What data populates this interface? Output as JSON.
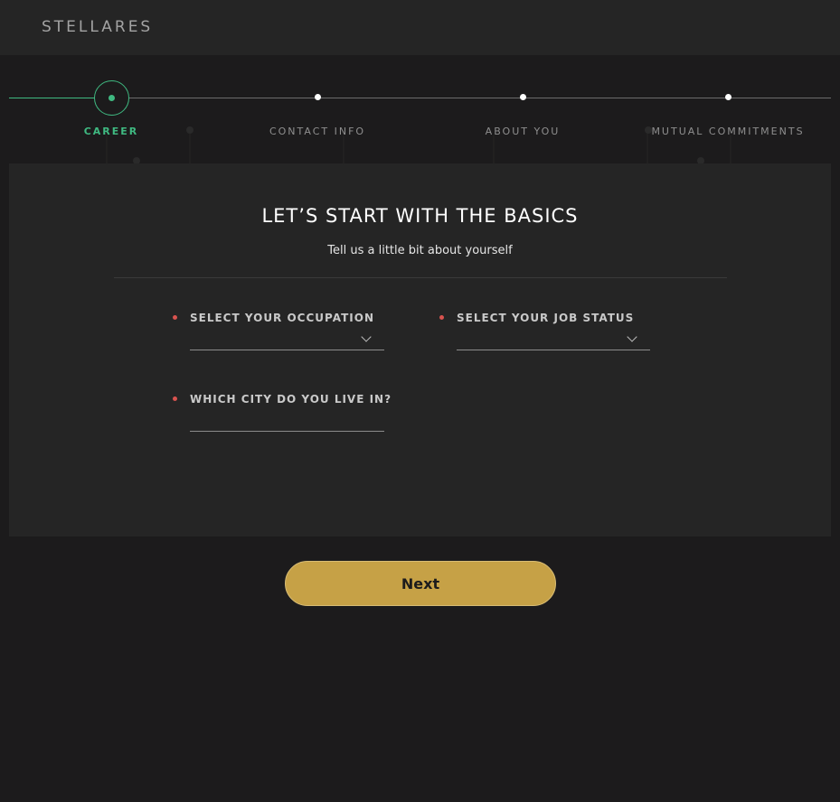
{
  "header": {
    "logo": "STELLARES"
  },
  "stepper": {
    "steps": [
      {
        "label": "CAREER",
        "active": true
      },
      {
        "label": "CONTACT INFO",
        "active": false
      },
      {
        "label": "ABOUT YOU",
        "active": false
      },
      {
        "label": "MUTUAL COMMITMENTS",
        "active": false
      }
    ]
  },
  "card": {
    "title": "LET’S START WITH THE BASICS",
    "subtitle": "Tell us a little bit about yourself",
    "fields": {
      "occupation": {
        "label": "SELECT YOUR OCCUPATION",
        "value": ""
      },
      "job_status": {
        "label": "SELECT YOUR JOB STATUS",
        "value": ""
      },
      "city": {
        "label": "WHICH CITY DO YOU LIVE IN?",
        "value": ""
      }
    }
  },
  "actions": {
    "next_label": "Next"
  },
  "colors": {
    "accent_green": "#3fb981",
    "button_gold": "#c6a146",
    "required_red": "#d9534f",
    "background": "#1c1b1c",
    "panel": "#252525"
  },
  "icons": [
    "chevron-down-icon",
    "required-dot-icon"
  ]
}
